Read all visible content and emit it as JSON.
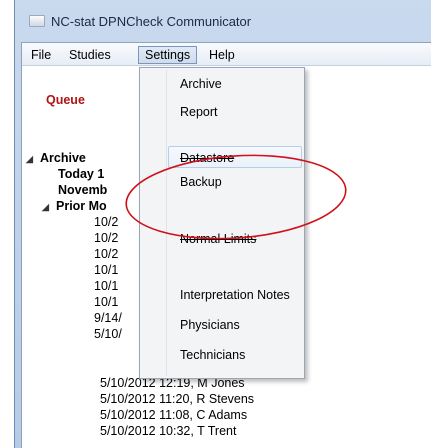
{
  "window": {
    "title": "NC-stat DPNCheck Communicator"
  },
  "menubar": {
    "items": [
      {
        "label": "File",
        "open": false
      },
      {
        "label": "Studies",
        "open": false
      },
      {
        "label": "Settings",
        "open": true
      },
      {
        "label": "Help",
        "open": false
      }
    ]
  },
  "tree": {
    "queue": "Queue",
    "archive": "Archive",
    "today": "Today 1",
    "november": "Novemb",
    "prior": "Prior Mo",
    "truncated_entries": [
      "10/2",
      "10/2",
      "10/2",
      "10/1",
      "10/1",
      "10/1",
      "9/14/",
      "5/10/"
    ],
    "entries": [
      "5/10/2012 12:19, M Jones",
      "5/10/2012 11:20, R Stevens",
      "5/10/2012 11:08, C Adams",
      "5/10/2012 10:32, T Trent"
    ]
  },
  "settings_menu": {
    "items": [
      "Archive",
      "Report",
      "Datastore",
      "Backup",
      "Normal Limits",
      "Interpretation Notes",
      "Physicians",
      "Technicians"
    ]
  },
  "colors": {
    "queue_text": "#b01414",
    "highlight_ellipse": "#d0101a"
  },
  "icons": {
    "app": "app-window-icon",
    "expand": "expand-triangle-icon"
  }
}
